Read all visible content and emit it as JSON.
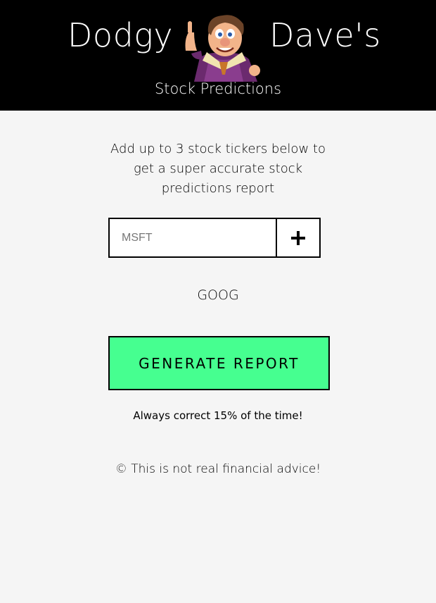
{
  "header": {
    "title_left": "Dodgy",
    "title_right": "Dave's",
    "subtitle": "Stock Predictions",
    "mascot_icon": "cartoon-mascot-dave"
  },
  "main": {
    "instructions": "Add up to 3 stock tickers below to get a super accurate stock predictions report",
    "ticker_input": {
      "placeholder": "MSFT",
      "value": ""
    },
    "add_button_icon": "plus-icon",
    "tickers": [
      "GOOG"
    ],
    "generate_button_label": "GENERATE REPORT",
    "tagline": "Always correct 15% of the time!",
    "footer": "© This is not real financial advice!"
  },
  "colors": {
    "header_bg": "#000000",
    "page_bg": "#f5f5f5",
    "button_green": "#46ff90"
  }
}
